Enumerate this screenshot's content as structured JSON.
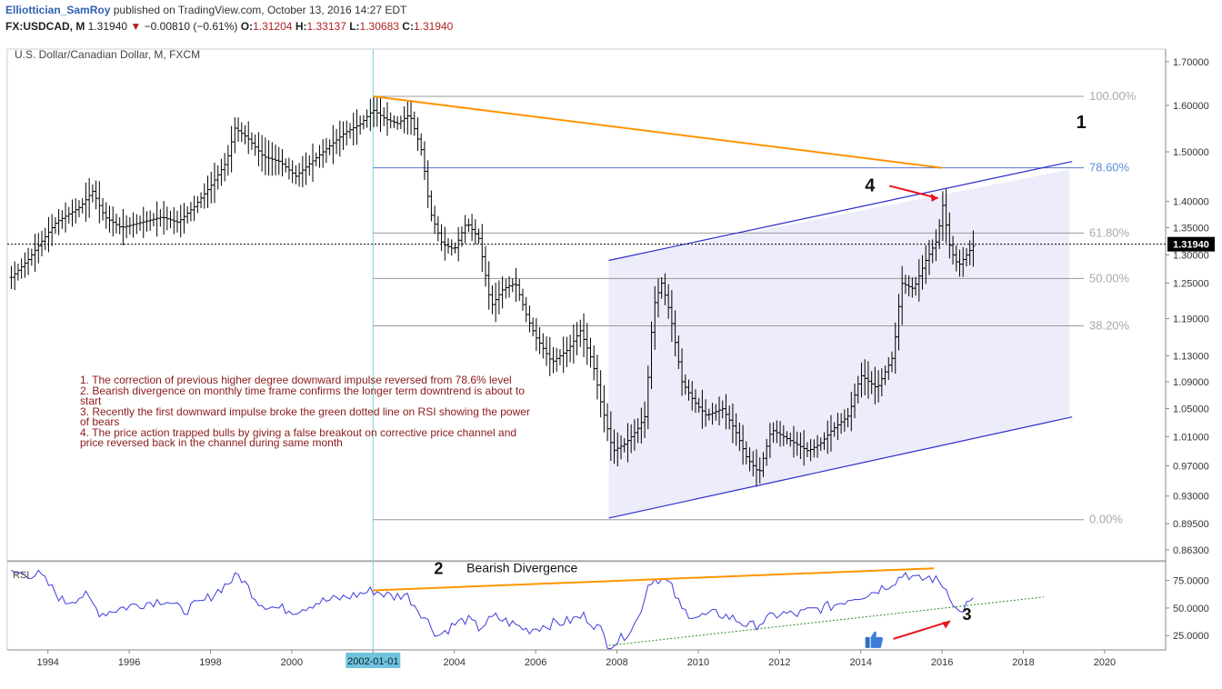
{
  "header": {
    "author": "Elliottician_SamRoy",
    "published_text": "published on TradingView.com, October 13, 2016 14:27 EDT",
    "symbol": "FX:USDCAD, M",
    "last": "1.31940",
    "change": "−0.00810 (−0.61%)",
    "open_label": "O:",
    "open": "1.31204",
    "high_label": "H:",
    "high": "1.33137",
    "low_label": "L:",
    "low": "1.30683",
    "close_label": "C:",
    "close": "1.31940"
  },
  "colors": {
    "candle": "#000000",
    "rsi": "#3c3cdc",
    "channel": "#2c2ccc",
    "channel_fill": "#e9e9f9",
    "trendline": "#ff9400",
    "fib_line": "#999999",
    "fib_786_text": "#5a8fd6",
    "note_text": "#8b1a1a",
    "arrow": "#e6171e",
    "vline": "#7fd0e8",
    "date_badge": "#6fc3db"
  },
  "chart_data": [
    {
      "type": "candlestick",
      "title": "U.S. Dollar/Canadian Dollar, M, FXCM",
      "ylim": [
        0.85,
        1.73
      ],
      "y_scale": "log",
      "y_ticks": [
        "1.70000",
        "1.60000",
        "1.50000",
        "1.40000",
        "1.35000",
        "1.30000",
        "1.25000",
        "1.19000",
        "1.13000",
        "1.09000",
        "1.05000",
        "1.01000",
        "0.97000",
        "0.93000",
        "0.89500",
        "0.86300"
      ],
      "x_ticks": [
        "1994",
        "1996",
        "1998",
        "2000",
        "2002",
        "2004",
        "2006",
        "2008",
        "2010",
        "2012",
        "2014",
        "2016",
        "2018",
        "2020"
      ],
      "xlim": [
        1993.0,
        2021.5
      ],
      "price_anchors": [
        [
          1993.1,
          1.26
        ],
        [
          1993.5,
          1.29
        ],
        [
          1993.8,
          1.32
        ],
        [
          1994.2,
          1.36
        ],
        [
          1994.8,
          1.39
        ],
        [
          1995.1,
          1.42
        ],
        [
          1995.4,
          1.37
        ],
        [
          1995.8,
          1.35
        ],
        [
          1996.3,
          1.36
        ],
        [
          1996.8,
          1.37
        ],
        [
          1997.2,
          1.36
        ],
        [
          1997.6,
          1.39
        ],
        [
          1998.0,
          1.43
        ],
        [
          1998.4,
          1.48
        ],
        [
          1998.6,
          1.55
        ],
        [
          1998.9,
          1.53
        ],
        [
          1999.3,
          1.49
        ],
        [
          1999.7,
          1.48
        ],
        [
          2000.1,
          1.45
        ],
        [
          2000.5,
          1.48
        ],
        [
          2000.9,
          1.51
        ],
        [
          2001.3,
          1.54
        ],
        [
          2001.7,
          1.56
        ],
        [
          2002.0,
          1.59
        ],
        [
          2002.3,
          1.57
        ],
        [
          2002.6,
          1.56
        ],
        [
          2002.9,
          1.58
        ],
        [
          2003.2,
          1.5
        ],
        [
          2003.4,
          1.38
        ],
        [
          2003.7,
          1.32
        ],
        [
          2004.0,
          1.31
        ],
        [
          2004.3,
          1.36
        ],
        [
          2004.6,
          1.33
        ],
        [
          2004.9,
          1.21
        ],
        [
          2005.2,
          1.24
        ],
        [
          2005.5,
          1.25
        ],
        [
          2005.8,
          1.19
        ],
        [
          2006.0,
          1.16
        ],
        [
          2006.4,
          1.12
        ],
        [
          2006.8,
          1.14
        ],
        [
          2007.1,
          1.17
        ],
        [
          2007.4,
          1.12
        ],
        [
          2007.6,
          1.06
        ],
        [
          2007.9,
          0.99
        ],
        [
          2008.2,
          1.0
        ],
        [
          2008.5,
          1.02
        ],
        [
          2008.7,
          1.04
        ],
        [
          2008.9,
          1.21
        ],
        [
          2009.1,
          1.25
        ],
        [
          2009.3,
          1.2
        ],
        [
          2009.6,
          1.09
        ],
        [
          2009.9,
          1.06
        ],
        [
          2010.2,
          1.04
        ],
        [
          2010.6,
          1.05
        ],
        [
          2010.9,
          1.02
        ],
        [
          2011.2,
          0.98
        ],
        [
          2011.5,
          0.96
        ],
        [
          2011.8,
          1.02
        ],
        [
          2012.1,
          1.01
        ],
        [
          2012.4,
          1.0
        ],
        [
          2012.7,
          0.99
        ],
        [
          2013.0,
          1.0
        ],
        [
          2013.3,
          1.02
        ],
        [
          2013.7,
          1.04
        ],
        [
          2014.0,
          1.1
        ],
        [
          2014.4,
          1.08
        ],
        [
          2014.8,
          1.13
        ],
        [
          2015.0,
          1.25
        ],
        [
          2015.3,
          1.24
        ],
        [
          2015.6,
          1.29
        ],
        [
          2015.9,
          1.33
        ],
        [
          2016.0,
          1.4
        ],
        [
          2016.2,
          1.31
        ],
        [
          2016.4,
          1.28
        ],
        [
          2016.6,
          1.3
        ],
        [
          2016.8,
          1.319
        ]
      ],
      "last_price_label": "1.31940",
      "fib_levels": [
        {
          "label": "100.00%",
          "value": 1.62
        },
        {
          "label": "78.60%",
          "value": 1.467
        },
        {
          "label": "61.80%",
          "value": 1.34
        },
        {
          "label": "50.00%",
          "value": 1.258
        },
        {
          "label": "38.20%",
          "value": 1.178
        },
        {
          "label": "0.00%",
          "value": 0.9
        }
      ],
      "channel": {
        "upper": [
          [
            2007.8,
            1.29
          ],
          [
            2019.2,
            1.48
          ]
        ],
        "lower": [
          [
            2007.8,
            0.902
          ],
          [
            2019.2,
            1.038
          ]
        ]
      },
      "trendline": [
        [
          2002.0,
          1.62
        ],
        [
          2016.0,
          1.467
        ]
      ],
      "vertical_line_date": "2002-01-01",
      "wave_labels": [
        {
          "text": "1",
          "x": 2019.3,
          "y": 1.55
        },
        {
          "text": "4",
          "x": 2014.1,
          "y": 1.42
        }
      ],
      "notes": [
        "1. The correction of previous higher degree downward impulse reversed from 78.6% level",
        "2. Bearish divergence on monthly time frame confirms the longer term downtrend is about to start",
        "3. Recently the first downward impulse broke the green dotted line on RSI showing the power of bears",
        "4. The price action trapped bulls by giving a false breakout on corrective price channel and price reversed back in the channel during same month"
      ]
    },
    {
      "type": "line",
      "title": "RSI",
      "ylim": [
        12,
        92
      ],
      "y_ticks": [
        "75.0000",
        "50.0000",
        "25.0000"
      ],
      "anchors": [
        [
          1993.1,
          82
        ],
        [
          1993.8,
          80
        ],
        [
          1994.4,
          55
        ],
        [
          1994.9,
          62
        ],
        [
          1995.3,
          45
        ],
        [
          1995.8,
          50
        ],
        [
          1996.3,
          54
        ],
        [
          1996.9,
          58
        ],
        [
          1997.3,
          47
        ],
        [
          1997.8,
          55
        ],
        [
          1998.4,
          72
        ],
        [
          1998.7,
          80
        ],
        [
          1999.2,
          55
        ],
        [
          1999.6,
          50
        ],
        [
          2000.1,
          48
        ],
        [
          2000.6,
          55
        ],
        [
          2001.1,
          58
        ],
        [
          2001.6,
          62
        ],
        [
          2002.0,
          66
        ],
        [
          2002.5,
          60
        ],
        [
          2002.8,
          63
        ],
        [
          2003.2,
          45
        ],
        [
          2003.6,
          25
        ],
        [
          2004.0,
          35
        ],
        [
          2004.3,
          40
        ],
        [
          2004.6,
          32
        ],
        [
          2005.0,
          42
        ],
        [
          2005.4,
          36
        ],
        [
          2005.8,
          30
        ],
        [
          2006.3,
          35
        ],
        [
          2006.8,
          38
        ],
        [
          2007.2,
          43
        ],
        [
          2007.6,
          30
        ],
        [
          2007.8,
          16
        ],
        [
          2008.1,
          22
        ],
        [
          2008.5,
          38
        ],
        [
          2008.8,
          75
        ],
        [
          2009.0,
          77
        ],
        [
          2009.3,
          72
        ],
        [
          2009.6,
          48
        ],
        [
          2010.0,
          42
        ],
        [
          2010.5,
          45
        ],
        [
          2010.9,
          40
        ],
        [
          2011.3,
          33
        ],
        [
          2011.6,
          38
        ],
        [
          2012.0,
          45
        ],
        [
          2012.4,
          44
        ],
        [
          2012.8,
          48
        ],
        [
          2013.3,
          52
        ],
        [
          2013.8,
          60
        ],
        [
          2014.2,
          63
        ],
        [
          2014.6,
          70
        ],
        [
          2014.9,
          76
        ],
        [
          2015.1,
          82
        ],
        [
          2015.4,
          75
        ],
        [
          2015.7,
          78
        ],
        [
          2016.0,
          72
        ],
        [
          2016.2,
          62
        ],
        [
          2016.4,
          44
        ],
        [
          2016.6,
          53
        ],
        [
          2016.8,
          56
        ]
      ],
      "divergence_price_line": [
        [
          2002.0,
          66
        ],
        [
          2015.8,
          86
        ]
      ],
      "support_line": [
        [
          2007.8,
          16
        ],
        [
          2018.5,
          60
        ]
      ],
      "annotations": [
        {
          "text": "2",
          "x": 2003.5,
          "y": 86
        },
        {
          "text": "Bearish Divergence",
          "x": 2004.3,
          "y": 86
        },
        {
          "text": "3",
          "x": 2016.5,
          "y": 44
        }
      ],
      "date_badge": "2002-01-01"
    }
  ]
}
